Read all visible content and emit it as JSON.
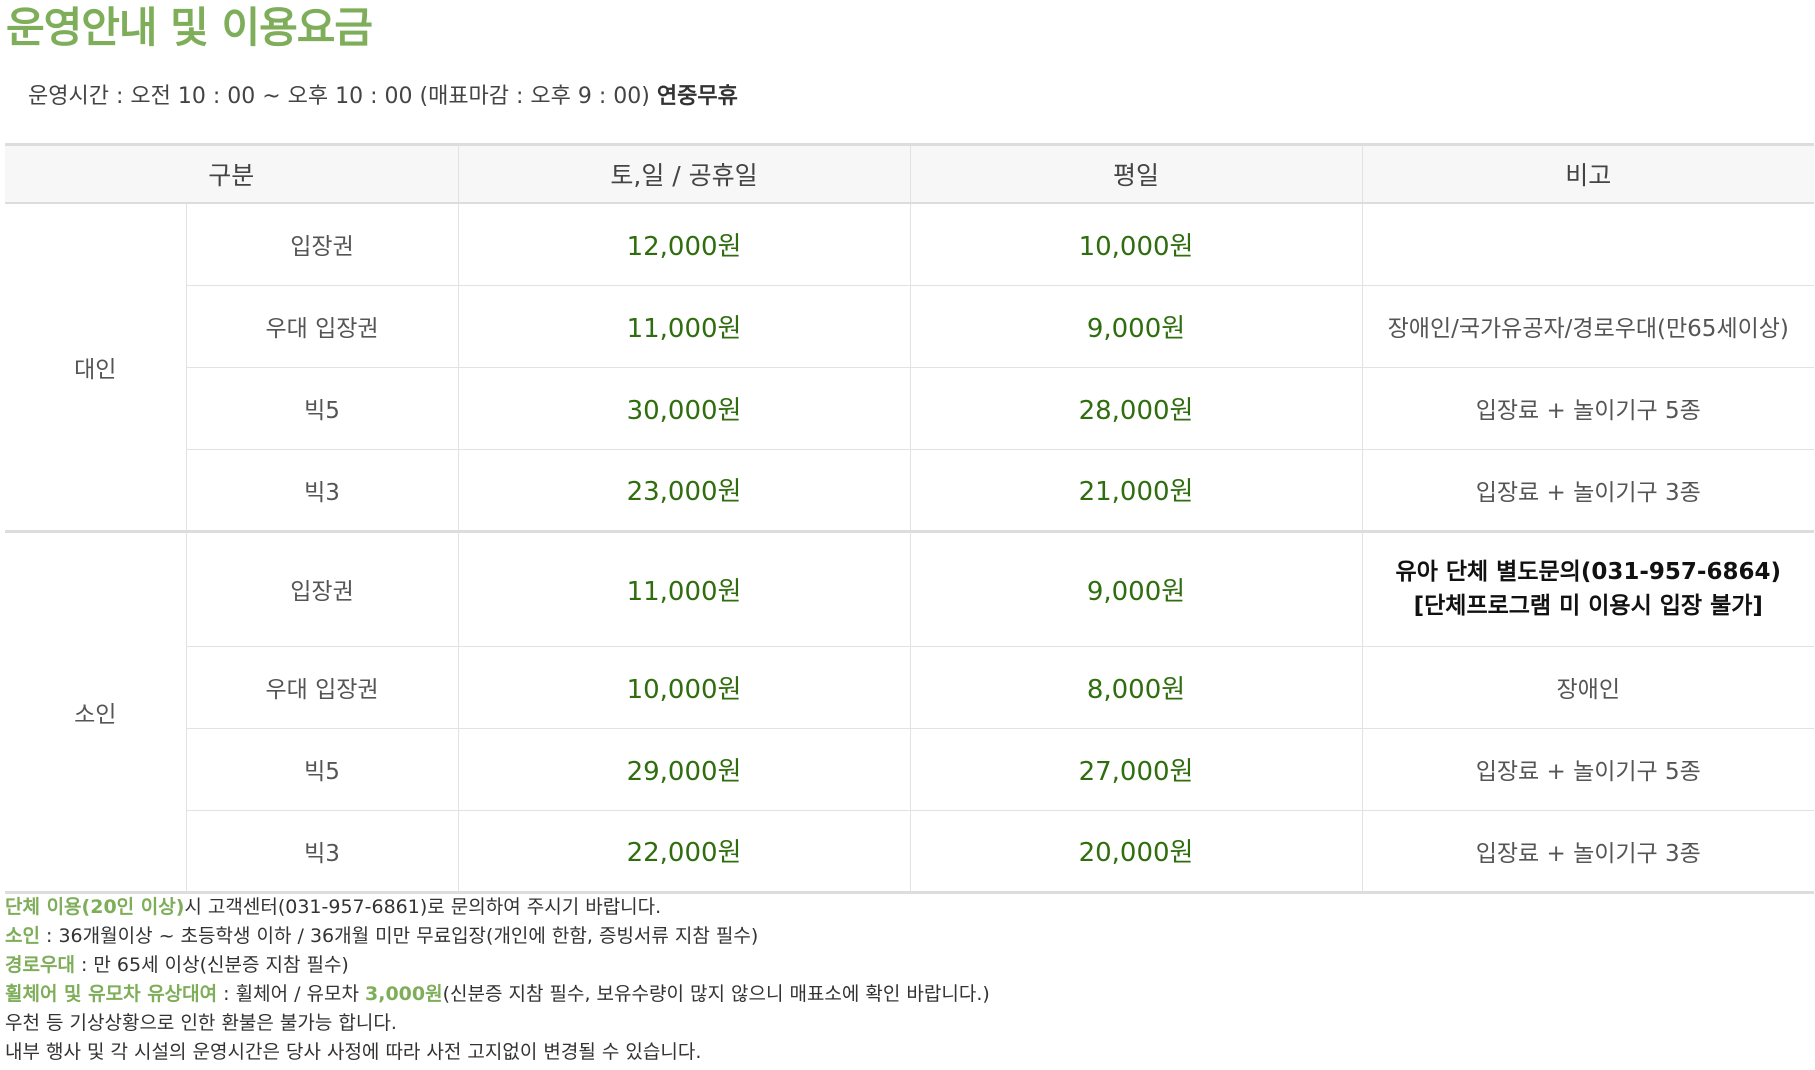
{
  "title": "운영안내 및 이용요금",
  "hours": {
    "text": "운영시간 : 오전 10 : 00 ~ 오후 10 : 00 (매표마감 : 오후 9 : 00)",
    "bold": "연중무휴"
  },
  "table": {
    "headers": [
      "구분",
      "토,일 / 공휴일",
      "평일",
      "비고"
    ],
    "groups": [
      {
        "name": "대인",
        "rows": [
          {
            "type": "입장권",
            "weekend": "12,000원",
            "weekday": "10,000원",
            "note": ""
          },
          {
            "type": "우대 입장권",
            "weekend": "11,000원",
            "weekday": "9,000원",
            "note": "장애인/국가유공자/경로우대(만65세이상)"
          },
          {
            "type": "빅5",
            "weekend": "30,000원",
            "weekday": "28,000원",
            "note": "입장료 + 놀이기구 5종"
          },
          {
            "type": "빅3",
            "weekend": "23,000원",
            "weekday": "21,000원",
            "note": "입장료 + 놀이기구 3종"
          }
        ]
      },
      {
        "name": "소인",
        "rows": [
          {
            "type": "입장권",
            "weekend": "11,000원",
            "weekday": "9,000원",
            "note_line1": "유아 단체 별도문의(031-957-6864)",
            "note_line2": "[단체프로그램 미 이용시 입장 불가]"
          },
          {
            "type": "우대 입장권",
            "weekend": "10,000원",
            "weekday": "8,000원",
            "note": "장애인"
          },
          {
            "type": "빅5",
            "weekend": "29,000원",
            "weekday": "27,000원",
            "note": "입장료 + 놀이기구 5종"
          },
          {
            "type": "빅3",
            "weekend": "22,000원",
            "weekday": "20,000원",
            "note": "입장료 + 놀이기구 3종"
          }
        ]
      }
    ]
  },
  "notes": {
    "group": {
      "hl": "단체 이용(20인 이상)",
      "text": "시 고객센터(031-957-6861)로 문의하여 주시기 바랍니다."
    },
    "child": {
      "hl": "소인",
      "text": " : 36개월이상 ~ 초등학생 이하 / 36개월 미만 무료입장(개인에 한함, 증빙서류 지참 필수)"
    },
    "senior": {
      "hl": "경로우대",
      "text": " : 만 65세 이상(신분증 지참 필수)"
    },
    "rental": {
      "hl": "휠체어 및 유모차 유상대여",
      "text1": " : 휠체어 / 유모차 ",
      "price": "3,000원",
      "text2": "(신분증 지참 필수, 보유수량이 많지 않으니 매표소에 확인 바랍니다.)"
    },
    "refund": "우천 등 기상상황으로 인한 환불은 불가능 합니다.",
    "schedule": "내부 행사 및 각 시설의 운영시간은 당사 사정에 따라 사전 고지없이 변경될 수 있습니다."
  },
  "colors": {
    "accent": "#7fae5a",
    "price": "#2f6d0e",
    "header_bg": "#f7f7f7"
  }
}
